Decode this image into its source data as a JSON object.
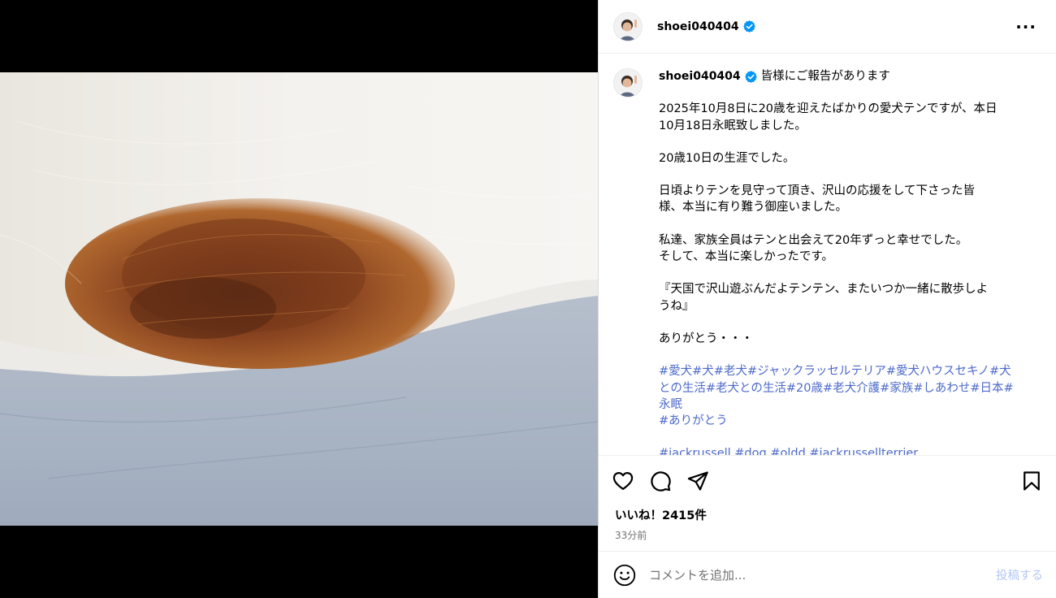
{
  "post": {
    "username": "shoei040404",
    "more_label": "···"
  },
  "caption": {
    "username": "shoei040404",
    "title": "皆様にご報告があります",
    "paragraphs": [
      "2025年10月8日に20歳を迎えたばかりの愛犬テンですが、本日\n10月18日永眠致しました。",
      "20歳10日の生涯でした。",
      "日頃よりテンを見守って頂き、沢山の応援をして下さった皆\n様、本当に有り難う御座いました。",
      "私達、家族全員はテンと出会えて20年ずっと幸せでした。\nそして、本当に楽しかったです。",
      "『天国で沢山遊ぶんだよテンテン、またいつか一緒に散歩しよ\nうね』",
      "ありがとう・・・"
    ],
    "hashtags": "#愛犬#犬#老犬#ジャックラッセルテリア#愛犬ハウスセキノ#犬\nとの生活#老犬との生活#20歳#老犬介護#家族#しあわせ#日本#\n永眠\n#ありがとう",
    "hashtags_cut": "#jackrussell #dog #oldd #jackrussellterrier"
  },
  "stats": {
    "likes": "いいね！2415件",
    "time": "33分前"
  },
  "comment_box": {
    "placeholder": "コメントを追加...",
    "post_label": "投稿する"
  },
  "icons": {
    "like": "heart-icon",
    "comment": "comment-icon",
    "share": "share-icon",
    "save": "bookmark-icon",
    "emoji": "emoji-icon",
    "verified": "verified-badge-icon",
    "more": "more-options-icon"
  },
  "colors": {
    "hashtag": "#4d6acb",
    "verified": "#0095f6",
    "post_disabled": "#b3c7f5"
  }
}
